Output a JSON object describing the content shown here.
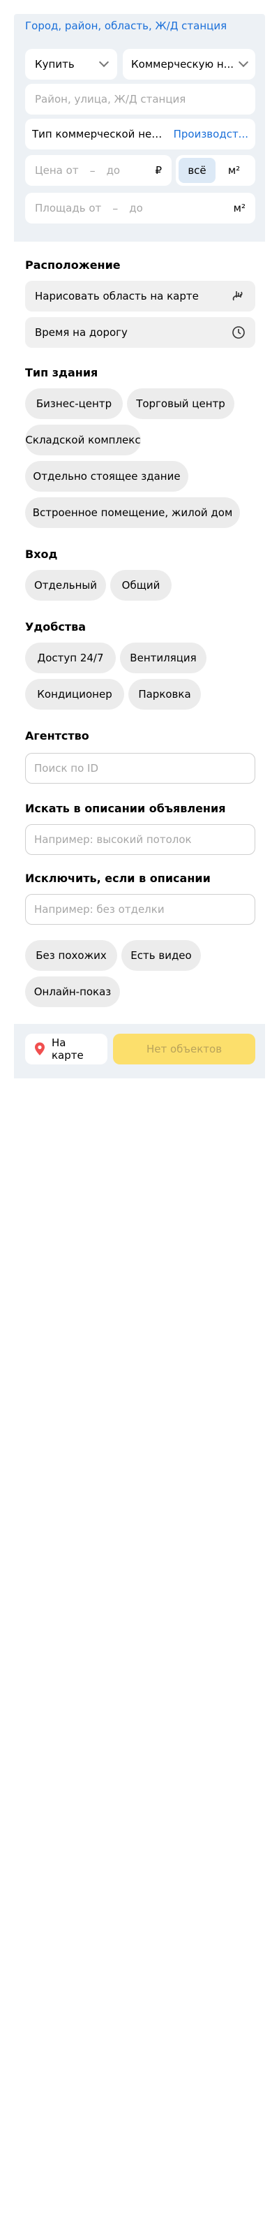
{
  "header": {
    "geo_link": "Город, район, область, Ж/Д станция"
  },
  "filters": {
    "deal_type": "Купить",
    "property_type": "Коммерческую н...",
    "search_placeholder": "Район, улица, Ж/Д станция",
    "commercial_type_label": "Тип коммерческой нед...",
    "commercial_type_value": "Производст...",
    "price_from": "Цена от",
    "price_to": "до",
    "currency": "₽",
    "unit_all": "всё",
    "unit_sqm": "м²",
    "area_from": "Площадь от",
    "area_to": "до",
    "area_unit": "м²"
  },
  "location": {
    "title": "Расположение",
    "draw_on_map": "Нарисовать область на карте",
    "travel_time": "Время на дорогу"
  },
  "building_type": {
    "title": "Тип здания",
    "options": [
      "Бизнес-центр",
      "Торговый центр",
      "Складской комплекс",
      "Отдельно стоящее здание",
      "Встроенное помещение, жилой дом"
    ]
  },
  "entrance": {
    "title": "Вход",
    "options": [
      "Отдельный",
      "Общий"
    ]
  },
  "amenities": {
    "title": "Удобства",
    "options": [
      "Доступ 24/7",
      "Вентиляция",
      "Кондиционер",
      "Парковка"
    ]
  },
  "agency": {
    "title": "Агентство",
    "placeholder": "Поиск по ID"
  },
  "description_search": {
    "title": "Искать в описании объявления",
    "placeholder": "Например: высокий потолок"
  },
  "description_exclude": {
    "title": "Исключить, если в описании",
    "placeholder": "Например: без отделки"
  },
  "extra": {
    "options": [
      "Без похожих",
      "Есть видео",
      "Онлайн-показ"
    ]
  },
  "bottom_bar": {
    "map_button": "На карте",
    "result_button": "Нет объектов"
  },
  "colors": {
    "accent": "#1a6fd9",
    "cta": "#fcdf6c",
    "pin": "#f04f4f"
  }
}
